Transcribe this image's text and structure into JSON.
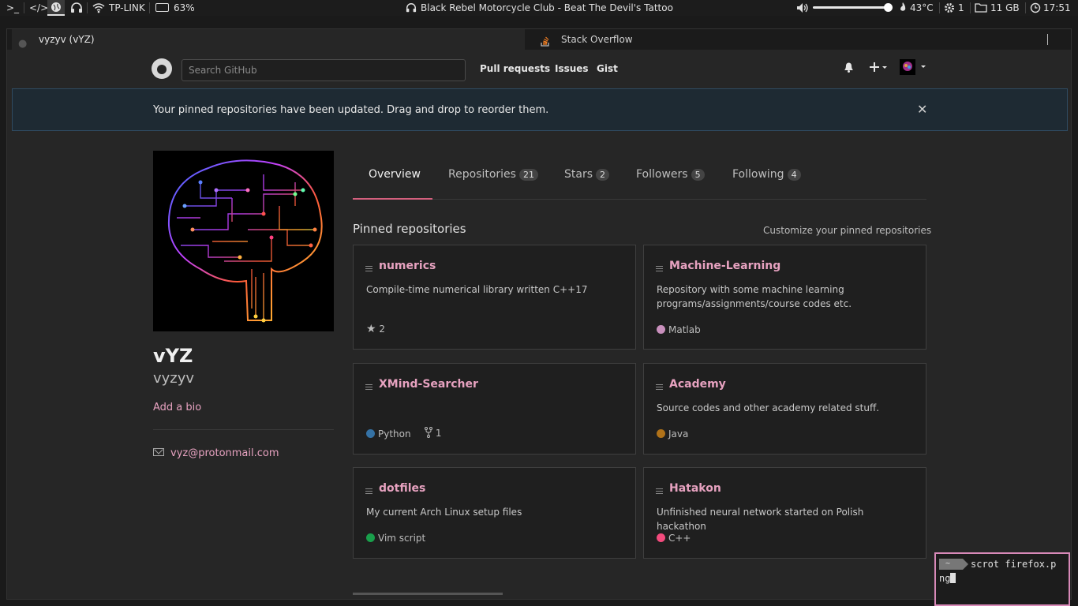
{
  "system_bar": {
    "terminal_glyph": ">_",
    "code_glyph": "</>",
    "wifi_name": "TP-LINK",
    "battery": "63%",
    "now_playing": "Black Rebel Motorcycle Club - Beat The Devil's Tattoo",
    "volume_level": 0.95,
    "temperature": "43°C",
    "cpu_count": "1",
    "disk_free": "11 GB",
    "clock": "17:51"
  },
  "browser": {
    "tabs": [
      {
        "label": "vyzyv (vYZ)",
        "active": true
      },
      {
        "label": "Stack Overflow",
        "active": false
      }
    ]
  },
  "github": {
    "search_placeholder": "Search GitHub",
    "nav": [
      "Pull requests",
      "Issues",
      "Gist"
    ],
    "flash_message": "Your pinned repositories have been updated. Drag and drop to reorder them.",
    "profile": {
      "name": "vYZ",
      "login": "vyzyv",
      "add_bio": "Add a bio",
      "email": "vyz@protonmail.com"
    },
    "tabs": [
      {
        "label": "Overview",
        "count": ""
      },
      {
        "label": "Repositories",
        "count": "21"
      },
      {
        "label": "Stars",
        "count": "2"
      },
      {
        "label": "Followers",
        "count": "5"
      },
      {
        "label": "Following",
        "count": "4"
      }
    ],
    "pinned_title": "Pinned repositories",
    "customize_link": "Customize your pinned repositories",
    "repos": [
      {
        "name": "numerics",
        "description": "Compile-time numerical library written C++17",
        "language": "",
        "lang_color": "",
        "stars": "2",
        "forks": ""
      },
      {
        "name": "Machine-Learning",
        "description": "Repository with some machine learning programs/assignments/course codes etc.",
        "language": "Matlab",
        "lang_color": "#c990bd",
        "stars": "",
        "forks": ""
      },
      {
        "name": "XMind-Searcher",
        "description": "",
        "language": "Python",
        "lang_color": "#3572A5",
        "stars": "",
        "forks": "1"
      },
      {
        "name": "Academy",
        "description": "Source codes and other academy related stuff.",
        "language": "Java",
        "lang_color": "#b07219",
        "stars": "",
        "forks": ""
      },
      {
        "name": "dotfiles",
        "description": "My current Arch Linux setup files",
        "language": "Vim script",
        "lang_color": "#199f4b",
        "stars": "",
        "forks": ""
      },
      {
        "name": "Hatakon",
        "description": "Unfinished neural network started on Polish hackathon",
        "language": "C++",
        "lang_color": "#f34b7d",
        "stars": "",
        "forks": ""
      }
    ]
  },
  "terminal": {
    "prompt": "~",
    "command_line1": "scrot firefox.p",
    "command_line2": "ng"
  }
}
